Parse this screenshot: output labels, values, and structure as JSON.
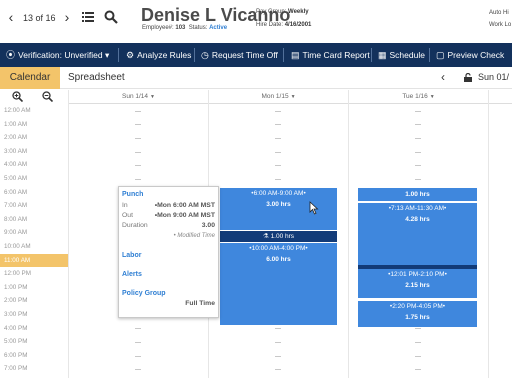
{
  "header": {
    "record_counter": "13 of 16",
    "employee_name": "Denise L Vicanno",
    "employee_id_label": "Employee#:",
    "employee_id": "103",
    "status_label": "Status:",
    "status": "Active",
    "pay_group_label": "Pay Group:",
    "pay_group": "Weekly",
    "hire_date_label": "Hire Date:",
    "hire_date": "4/16/2001",
    "right_hint_1": "Auto Hi",
    "right_hint_2": "Work Lo"
  },
  "toolbar": {
    "verification": "Verification: Unverified",
    "analyze": "Analyze Rules",
    "request_time_off": "Request Time Off",
    "time_card_report": "Time Card Report",
    "schedule": "Schedule",
    "preview_check": "Preview Check"
  },
  "tabs": {
    "calendar": "Calendar",
    "spreadsheet": "Spreadsheet",
    "current_day": "Sun 01/"
  },
  "columns": [
    {
      "label": "Sun 1/14"
    },
    {
      "label": "Mon 1/15"
    },
    {
      "label": "Tue 1/16"
    }
  ],
  "times": [
    "12:00 AM",
    "1:00 AM",
    "2:00 AM",
    "3:00 AM",
    "4:00 AM",
    "5:00 AM",
    "6:00 AM",
    "7:00 AM",
    "8:00 AM",
    "9:00 AM",
    "10:00 AM",
    "11:00 AM",
    "12:00 PM",
    "1:00 PM",
    "2:00 PM",
    "3:00 PM",
    "4:00 PM",
    "5:00 PM",
    "6:00 PM",
    "7:00 PM"
  ],
  "highlight_time_index": 11,
  "monday": {
    "shift1_time": "6:00 AM-9:00 AM",
    "shift1_hrs": "3.00 hrs",
    "meal_hrs": "1.00 hrs",
    "shift2_time": "10:00 AM-4:00 PM",
    "shift2_hrs": "6.00 hrs"
  },
  "tuesday": {
    "block1_hrs": "1.00 hrs",
    "shift1_time": "7:13 AM-11:30 AM",
    "shift1_hrs": "4.28 hrs",
    "shift2_time": "12:01 PM-2:10 PM",
    "shift2_hrs": "2.15 hrs",
    "shift3_time": "2:20 PM-4:05 PM",
    "shift3_hrs": "1.75 hrs"
  },
  "popover": {
    "punch": "Punch",
    "in_label": "In",
    "in_value": "Mon 6:00 AM MST",
    "out_label": "Out",
    "out_value": "Mon 9:00 AM MST",
    "duration_label": "Duration",
    "duration_value": "3.00",
    "modified": "Modified Time",
    "labor": "Labor",
    "alerts": "Alerts",
    "policy_group": "Policy Group",
    "policy_value": "Full Time"
  },
  "colors": {
    "nav_bg": "#13315c",
    "accent_tab": "#f3c46a",
    "shift_blue": "#3f87dd",
    "meal_dark": "#123b78",
    "link_blue": "#2f7fd3"
  }
}
